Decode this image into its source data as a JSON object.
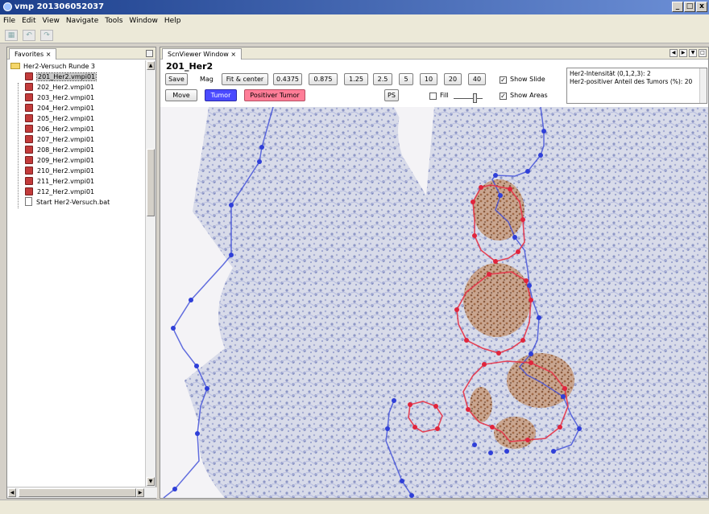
{
  "window": {
    "title": "vmp 201306052037",
    "buttons": [
      "_",
      "□",
      "x"
    ]
  },
  "menu": {
    "items": [
      "File",
      "Edit",
      "View",
      "Navigate",
      "Tools",
      "Window",
      "Help"
    ]
  },
  "toolbar": {
    "icons": [
      "open-icon",
      "undo-icon",
      "redo-icon"
    ]
  },
  "favorites": {
    "tab_label": "Favorites",
    "tab_close": "×",
    "folder": "Her2-Versuch Runde 3",
    "files": [
      "201_Her2.vmpi01",
      "202_Her2.vmpi01",
      "203_Her2.vmpi01",
      "204_Her2.vmpi01",
      "205_Her2.vmpi01",
      "206_Her2.vmpi01",
      "207_Her2.vmpi01",
      "208_Her2.vmpi01",
      "209_Her2.vmpi01",
      "210_Her2.vmpi01",
      "211_Her2.vmpi01",
      "212_Her2.vmpi01"
    ],
    "selected_index": 0,
    "batch": "Start Her2-Versuch.bat"
  },
  "viewer": {
    "tab_label": "ScnViewer Window",
    "tab_close": "×",
    "slide_title": "201_Her2",
    "save": "Save",
    "mag_label": "Mag",
    "fit": "Fit & center",
    "zoom_levels": [
      "0.4375",
      "0.875",
      "1.25",
      "2.5",
      "5",
      "10",
      "20",
      "40"
    ],
    "move": "Move",
    "tumor": "Tumor",
    "positive_tumor": "Positiver Tumor",
    "ps": "PS",
    "fill_label": "Fill",
    "fill_checked": false,
    "show_slide_label": "Show Slide",
    "show_slide_checked": true,
    "show_areas_label": "Show Areas",
    "show_areas_checked": true,
    "check_mark": "✓",
    "info_lines": [
      "Her2-Intensität (0,1,2,3): 2",
      "Her2-positiver Anteil des Tumors (%): 20"
    ]
  },
  "colors": {
    "tumor_outline": "#2f3fd8",
    "positive_outline": "#e0304a",
    "tumor_button": "#4a4aff",
    "positive_button": "#ff7d97"
  }
}
